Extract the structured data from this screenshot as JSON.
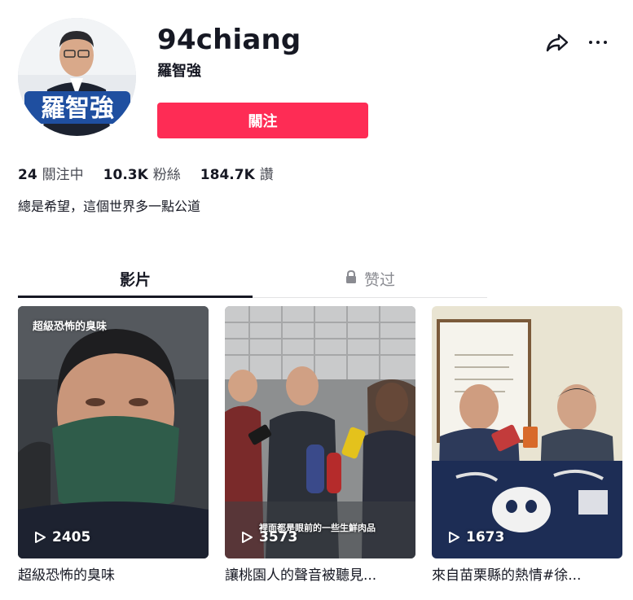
{
  "profile": {
    "username": "94chiang",
    "nickname": "羅智強",
    "avatar_sign_text": "羅智強",
    "follow_label": "關注",
    "bio": "總是希望，這個世界多一點公道",
    "stats": {
      "following_count": "24",
      "following_label": "關注中",
      "followers_count": "10.3K",
      "followers_label": "粉絲",
      "likes_count": "184.7K",
      "likes_label": "讚"
    }
  },
  "tabs": [
    {
      "label": "影片",
      "active": true
    },
    {
      "label": "赞过",
      "locked": true
    }
  ],
  "videos": [
    {
      "overlay_title": "超級恐怖的臭味",
      "views": "2405",
      "description": "超級恐怖的臭味"
    },
    {
      "overlay_caption": "裡面都是眼前的一些生鮮肉品",
      "views": "3573",
      "description": "讓桃園人的聲音被聽見..."
    },
    {
      "views": "1673",
      "description": "來自苗栗縣的熱情#徐..."
    }
  ],
  "colors": {
    "accent": "#fe2c55",
    "text": "#161823",
    "muted": "#8a8b91"
  },
  "icons": [
    "share-icon",
    "more-icon",
    "lock-icon",
    "play-icon"
  ]
}
